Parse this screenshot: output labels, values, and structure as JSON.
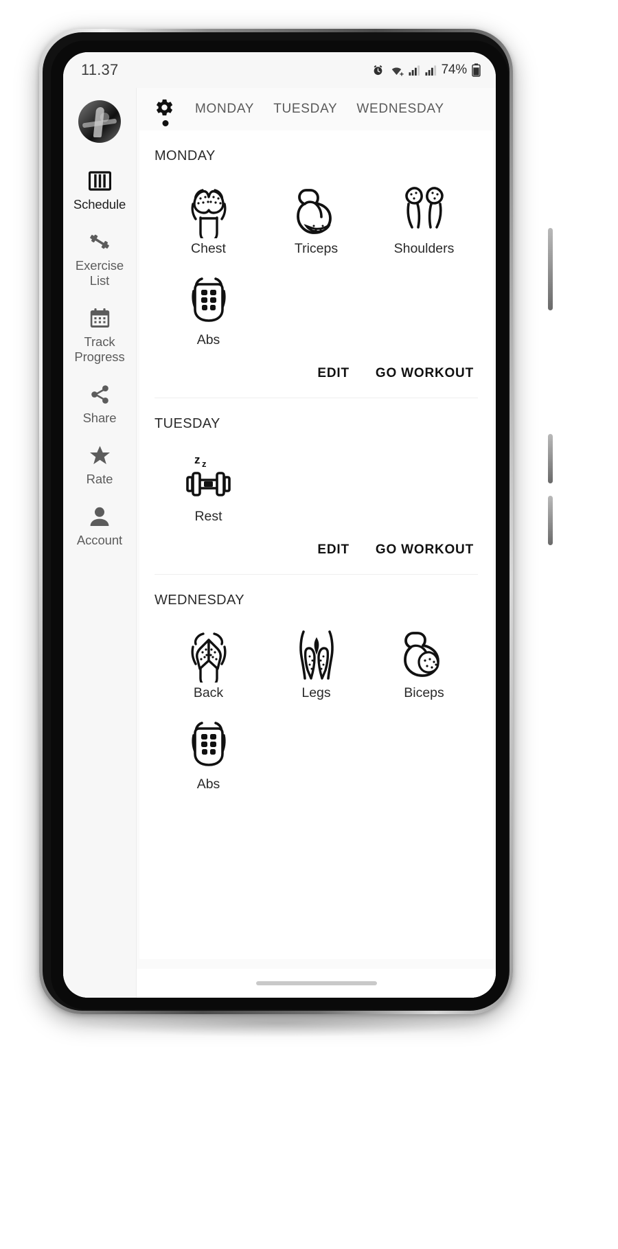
{
  "status_bar": {
    "time": "11.37",
    "battery_percent": "74%",
    "icons": [
      "alarm-icon",
      "wifi-icon",
      "signal-icon",
      "signal-icon",
      "battery-icon"
    ]
  },
  "sidebar": {
    "avatar_name": "user-avatar",
    "items": [
      {
        "label": "Schedule",
        "icon": "schedule-bars-icon",
        "active": true
      },
      {
        "label": "Exercise\nList",
        "label_line1": "Exercise",
        "label_line2": "List",
        "icon": "dumbbell-icon",
        "active": false
      },
      {
        "label": "Track\nProgress",
        "label_line1": "Track",
        "label_line2": "Progress",
        "icon": "calendar-icon",
        "active": false
      },
      {
        "label": "Share",
        "icon": "share-icon",
        "active": false
      },
      {
        "label": "Rate",
        "icon": "star-icon",
        "active": false
      },
      {
        "label": "Account",
        "icon": "person-icon",
        "active": false
      }
    ]
  },
  "topbar": {
    "settings_icon": "gear-icon",
    "tabs": [
      {
        "label": "MONDAY",
        "selected": false
      },
      {
        "label": "TUESDAY",
        "selected": false
      },
      {
        "label": "WEDNESDAY",
        "selected": false
      }
    ]
  },
  "schedule": {
    "edit_label": "EDIT",
    "go_workout_label": "GO WORKOUT",
    "days": [
      {
        "title": "MONDAY",
        "muscles": [
          {
            "name": "Chest",
            "icon": "chest-icon"
          },
          {
            "name": "Triceps",
            "icon": "triceps-icon"
          },
          {
            "name": "Shoulders",
            "icon": "shoulders-icon"
          },
          {
            "name": "Abs",
            "icon": "abs-icon"
          }
        ]
      },
      {
        "title": "TUESDAY",
        "muscles": [
          {
            "name": "Rest",
            "icon": "rest-dumbbell-icon"
          }
        ]
      },
      {
        "title": "WEDNESDAY",
        "muscles": [
          {
            "name": "Back",
            "icon": "back-icon"
          },
          {
            "name": "Legs",
            "icon": "legs-icon"
          },
          {
            "name": "Biceps",
            "icon": "biceps-icon"
          },
          {
            "name": "Abs",
            "icon": "abs-icon"
          }
        ]
      }
    ]
  },
  "colors": {
    "screen_bg": "#fafafa",
    "card_bg": "#ffffff",
    "rail_bg": "#f7f7f7",
    "text_primary": "#2a2a2a",
    "text_secondary": "#5c5c5c",
    "accent": "#111111"
  }
}
